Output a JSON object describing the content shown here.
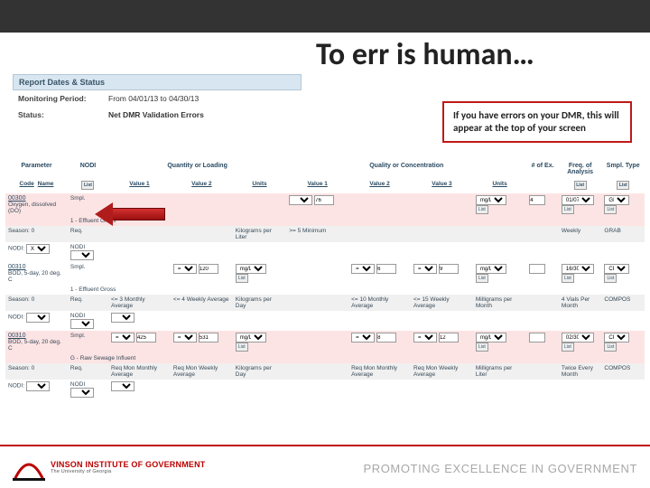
{
  "slide": {
    "title": "To err is human…",
    "callout": "If you have errors on your DMR, this will appear at the top of your screen"
  },
  "status_panel": {
    "header": "Report Dates & Status",
    "rows": [
      {
        "label": "Monitoring Period:",
        "value": "From 04/01/13 to 04/30/13"
      },
      {
        "label": "Status:",
        "value": "Net DMR Validation Errors"
      }
    ]
  },
  "table": {
    "headers": {
      "parameter": "Parameter",
      "nodi": "NODI",
      "qty": "Quantity or Loading",
      "qual": "Quality or Concentration",
      "num_ex": "# of Ex.",
      "freq": "Freq. of Analysis",
      "smpl_type": "Smpl. Type"
    },
    "subheaders": {
      "code": "Code",
      "name": "Name",
      "list": "List",
      "v1": "Value 1",
      "v2": "Value 2",
      "v3": "Value 3",
      "units": "Units"
    },
    "rows": [
      {
        "code": "00300",
        "name": "Oxygen, dissolved (DO)",
        "smpl_row": {
          "label": "Smpl.",
          "qv1": "",
          "qual_v1": "76"
        },
        "detail": "1 - Effluent Gross",
        "req_row": {
          "label": "Req.",
          "season": "Season: 0",
          "qual_v1": ">= 5 Minimum",
          "units": "Kilograms per Liter",
          "freq": "Weekly",
          "smpl": "GRAB"
        },
        "nodi_row": {
          "label": "NODI:",
          "sel": "X"
        },
        "num_ex": "4",
        "freq_sel": "01/07",
        "smpl_sel": "GR",
        "units_sel": "mg/L"
      },
      {
        "code": "00310",
        "name": "BOD, 5-day, 20 deg. C",
        "smpl_row": {
          "label": "Smpl.",
          "v2": "120",
          "units": "mg/L",
          "qual_v2": "6",
          "qual_v3": "9"
        },
        "detail": "1 - Effluent Gross",
        "req_row": {
          "label": "Req.",
          "season": "Season: 0",
          "v1": "<= 3 Monthly Average",
          "v2": "<= 4 Weekly Average",
          "units": "Kilograms per Day",
          "qual_v2": "<= 10 Monthly Average",
          "qual_v3": "<= 15 Weekly Average",
          "qunits": "Milligrams per Month",
          "freq": "4 Vials Per Month",
          "smpl": "COMPOS"
        },
        "nodi_row": {
          "label": "NODI:"
        },
        "num_ex": "",
        "freq_sel": "16/30",
        "smpl_sel": "CP",
        "units_sel": "mg/L"
      },
      {
        "code": "00310",
        "name": "BOD, 5-day, 20 deg. C",
        "smpl_row": {
          "label": "Smpl.",
          "v1": "425",
          "v2": "531",
          "units": "mg/L",
          "qual_v2": "8",
          "qual_v3": "12"
        },
        "detail": "G - Raw Sewage Influent",
        "req_row": {
          "label": "Req.",
          "season": "Season: 0",
          "v1": "Req Mon Monthly Average",
          "v2": "Req Mon Weekly Average",
          "units": "Kilograms per Day",
          "qual_v2": "Req Mon Monthly Average",
          "qual_v3": "Req Mon Weekly Average",
          "qunits": "Milligrams per Liter",
          "freq": "Twice Every Month",
          "smpl": "COMPOS"
        },
        "nodi_row": {
          "label": "NODI:"
        },
        "num_ex": "",
        "freq_sel": "02/30",
        "smpl_sel": "CP",
        "units_sel": "mg/L"
      }
    ]
  },
  "footer": {
    "logo_main": "VINSON INSTITUTE OF GOVERNMENT",
    "logo_sub": "The University of Georgia",
    "slogan": "PROMOTING EXCELLENCE IN GOVERNMENT"
  }
}
